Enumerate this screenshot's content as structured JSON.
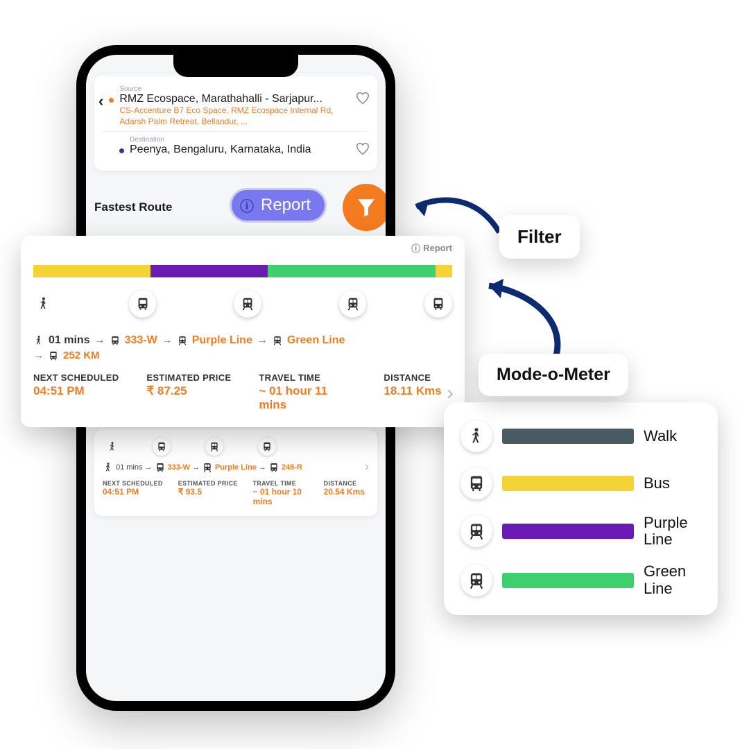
{
  "source": {
    "label": "Source",
    "main": "RMZ Ecospace, Marathahalli - Sarjapur...",
    "sub": "CS-Accenture B7 Eco Space, RMZ Ecospace Internal Rd, Adarsh Palm Retreat, Bellandur, ..."
  },
  "destination": {
    "label": "Destination",
    "main": "Peenya, Bengaluru, Karnataka, India"
  },
  "section_title": "Fastest Route",
  "report_label": "Report",
  "big_card": {
    "report": "Report",
    "meter": [
      {
        "color": "#f3d335",
        "pct": 28
      },
      {
        "color": "#6a1bb3",
        "pct": 28
      },
      {
        "color": "#3ed06e",
        "pct": 40
      },
      {
        "color": "#f3d335",
        "pct": 4
      }
    ],
    "seq_walk_time": "01 mins",
    "seq_items": [
      "333-W",
      "Purple Line",
      "Green Line"
    ],
    "extra_km": "252 KM",
    "stats": {
      "next_label": "NEXT SCHEDULED",
      "next_val": "04:51 PM",
      "price_label": "ESTIMATED PRICE",
      "price_val": "₹  87.25",
      "time_label": "TRAVEL TIME",
      "time_val": "~ 01 hour 11 mins",
      "dist_label": "DISTANCE",
      "dist_val": "18.11 Kms"
    }
  },
  "mini_card": {
    "walk_time": "01 mins",
    "seq": [
      "333-W",
      "Purple Line",
      "248-R"
    ],
    "stats": {
      "next_label": "NEXT SCHEDULED",
      "next_val": "04:51 PM",
      "price_label": "ESTIMATED PRICE",
      "price_val": "₹  93.5",
      "time_label": "TRAVEL TIME",
      "time_val": "~ 01 hour 10 mins",
      "dist_label": "DISTANCE",
      "dist_val": "20.54 Kms"
    }
  },
  "callouts": {
    "filter": "Filter",
    "modeometer": "Mode-o-Meter"
  },
  "legend": {
    "items": [
      {
        "label": "Walk",
        "color": "#4a5a63"
      },
      {
        "label": "Bus",
        "color": "#f3d335"
      },
      {
        "label": "Purple Line",
        "color": "#6a1bb3"
      },
      {
        "label": "Green Line",
        "color": "#3ed06e"
      }
    ]
  }
}
